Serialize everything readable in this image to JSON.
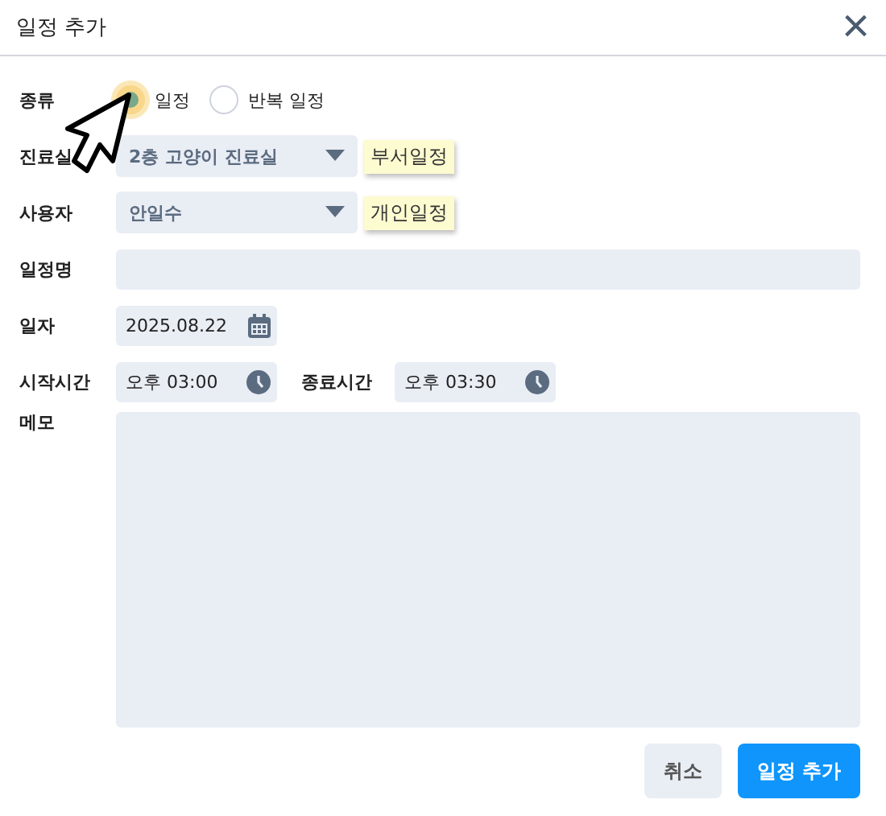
{
  "window": {
    "title": "일정 추가",
    "close": "×"
  },
  "type": {
    "label": "종류",
    "options": [
      {
        "label": "일정",
        "selected": true
      },
      {
        "label": "반복 일정",
        "selected": false
      }
    ]
  },
  "room": {
    "label": "진료실",
    "value": "2층 고양이 진료실",
    "tag": "부서일정"
  },
  "user": {
    "label": "사용자",
    "value": "안일수",
    "tag": "개인일정"
  },
  "name": {
    "label": "일정명"
  },
  "date": {
    "label": "일자",
    "value": "2025.08.22"
  },
  "start": {
    "label": "시작시간",
    "value": "오후 03:00"
  },
  "end": {
    "label": "종료시간",
    "value": "오후 03:30"
  },
  "memo": {
    "label": "메모"
  },
  "buttons": [
    {
      "label": "취소",
      "kind": "secondary"
    },
    {
      "label": "일정 추가",
      "kind": "primary"
    }
  ]
}
